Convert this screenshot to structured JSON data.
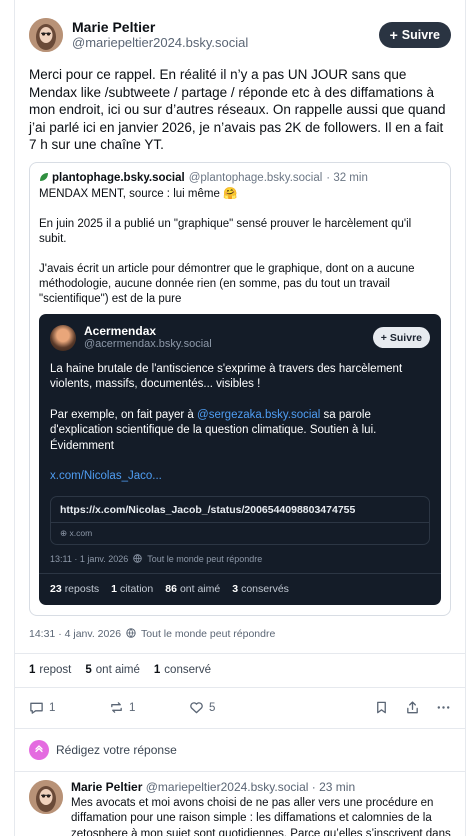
{
  "post": {
    "author": {
      "display_name": "Marie Peltier",
      "handle": "@mariepeltier2024.bsky.social"
    },
    "follow_label": "Suivre",
    "text": "Merci pour ce rappel. En réalité il n’y a pas UN JOUR sans que Mendax like /subtweete / partage / réponde etc à des diffamations à mon endroit, ici ou sur d’autres réseaux. On rappelle aussi que quand j’ai parlé ici en janvier 2026, je n’avais pas 2K de followers. Il en a fait 7 h sur une chaîne YT.",
    "timestamp": "14:31 · 4 janv. 2026",
    "reply_setting": "Tout le monde peut répondre",
    "stats": {
      "repost_count": "1",
      "repost_label": "repost",
      "like_count": "5",
      "like_label": "ont aimé",
      "saved_count": "1",
      "saved_label": "conservé"
    },
    "actions": {
      "reply_count": "1",
      "repost_count": "1",
      "like_count": "5"
    }
  },
  "quote": {
    "display_name": "plantophage.bsky.social",
    "handle": "@plantophage.bsky.social",
    "time": "· 32 min",
    "paragraphs": [
      "MENDAX MENT, source : lui même 🤗",
      "En juin 2025 il a publié un \"graphique\" sensé prouver le harcèlement qu'il subit.",
      "J'avais écrit un article pour démontrer que le graphique, dont on a aucune méthodologie, aucune donnée rien (en somme, pas du tout un travail \"scientifique\") est de la pure"
    ]
  },
  "embed": {
    "display_name": "Acermendax",
    "handle": "@acermendax.bsky.social",
    "follow_label": "Suivre",
    "p1": "La haine brutale de l'antiscience s'exprime à travers des harcèlement violents, massifs, documentés... visibles !",
    "p2_before": "Par exemple, on fait payer à ",
    "p2_mention": "@sergezaka.bsky.social",
    "p2_after": " sa parole d'explication scientifique de la question climatique. Soutien à lui. Évidemment",
    "link_text": "x.com/Nicolas_Jaco...",
    "card_url": "https://x.com/Nicolas_Jacob_/status/2006544098803474755",
    "card_domain": "x.com",
    "timestamp": "13:11 · 1 janv. 2026",
    "reply_setting": "Tout le monde peut répondre",
    "stats": {
      "reposts_count": "23",
      "reposts_label": "reposts",
      "citation_count": "1",
      "citation_label": "citation",
      "likes_count": "86",
      "likes_label": "ont aimé",
      "saved_count": "3",
      "saved_label": "conservés"
    }
  },
  "composer": {
    "prompt": "Rédigez votre réponse"
  },
  "reply": {
    "display_name": "Marie Peltier",
    "handle": "@mariepeltier2024.bsky.social",
    "time": "· 23 min",
    "text": "Mes avocats et moi avons choisi de ne pas aller vers une procédure en diffamation pour une raison simple : les diffamations et calomnies de la zetosphere à mon sujet sont quotidiennes. Parce qu’elles s’inscrivent dans une campagne de harcèlement de masse, pour laquelle j’ai déposé plainte."
  }
}
